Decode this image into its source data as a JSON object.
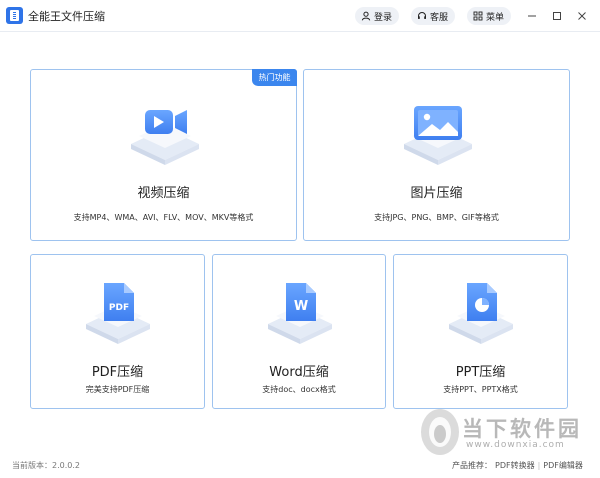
{
  "app": {
    "title": "全能王文件压缩"
  },
  "titlebar": {
    "login_label": "登录",
    "service_label": "客服",
    "menu_label": "菜单"
  },
  "cards": {
    "video": {
      "title": "视频压缩",
      "desc": "支持MP4、WMA、AVI、FLV、MOV、MKV等格式",
      "badge": "热门功能"
    },
    "image": {
      "title": "图片压缩",
      "desc": "支持JPG、PNG、BMP、GIF等格式"
    },
    "pdf": {
      "title": "PDF压缩",
      "desc": "完美支持PDF压缩",
      "icon_text": "PDF"
    },
    "word": {
      "title": "Word压缩",
      "desc": "支持doc、docx格式",
      "icon_text": "W"
    },
    "ppt": {
      "title": "PPT压缩",
      "desc": "支持PPT、PPTX格式"
    }
  },
  "footer": {
    "version": "当前版本：2.0.0.2",
    "products_label": "产品推荐：",
    "pdf_converter": "PDF转换器",
    "pdf_editor": "PDF编辑器"
  },
  "watermark": {
    "text": "当下软件园",
    "url": "www.downxia.com"
  },
  "colors": {
    "accent": "#3b86ee",
    "card_border": "#9ec3ef",
    "icon_blue": "#4f8ef5"
  }
}
